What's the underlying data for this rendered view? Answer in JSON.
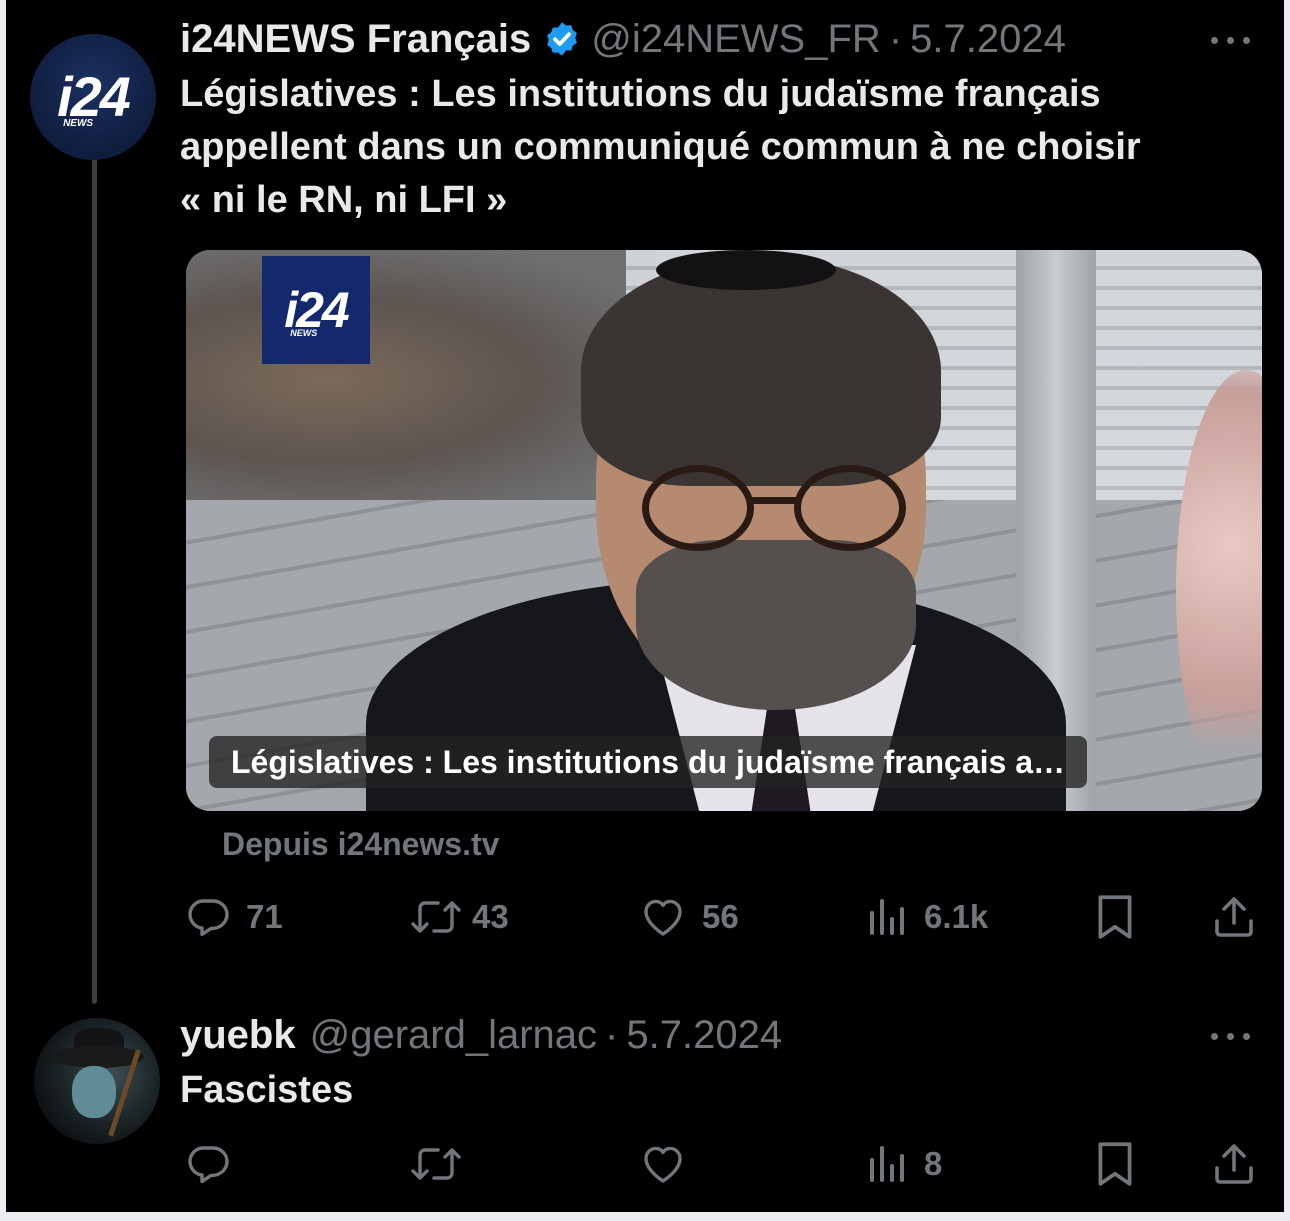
{
  "tweet": {
    "avatar_logo": "i24",
    "avatar_logo_sub": "NEWS",
    "display_name": "i24NEWS Français",
    "verified_icon": "verified-badge-icon",
    "handle": "@i24NEWS_FR",
    "separator": "·",
    "date": "5.7.2024",
    "text_line1": "Législatives : Les institutions du judaïsme français",
    "text_line2": "appellent dans un communiqué commun à ne choisir",
    "text_line3": "« ni le RN, ni LFI »",
    "media": {
      "logo": "i24",
      "logo_sub": "NEWS",
      "caption": "Législatives : Les institutions du judaïsme français a…",
      "source": "Depuis i24news.tv"
    },
    "actions": {
      "replies": "71",
      "reposts": "43",
      "likes": "56",
      "views": "6.1k"
    }
  },
  "reply": {
    "display_name": "yuebk",
    "handle": "@gerard_larnac",
    "separator": "·",
    "date": "5.7.2024",
    "text": "Fascistes",
    "actions": {
      "views": "8"
    }
  },
  "colors": {
    "background": "#000000",
    "text_primary": "#e7e9ea",
    "text_secondary": "#71767b",
    "verified": "#1d9bf0",
    "outer_border": "#ebedf0"
  }
}
